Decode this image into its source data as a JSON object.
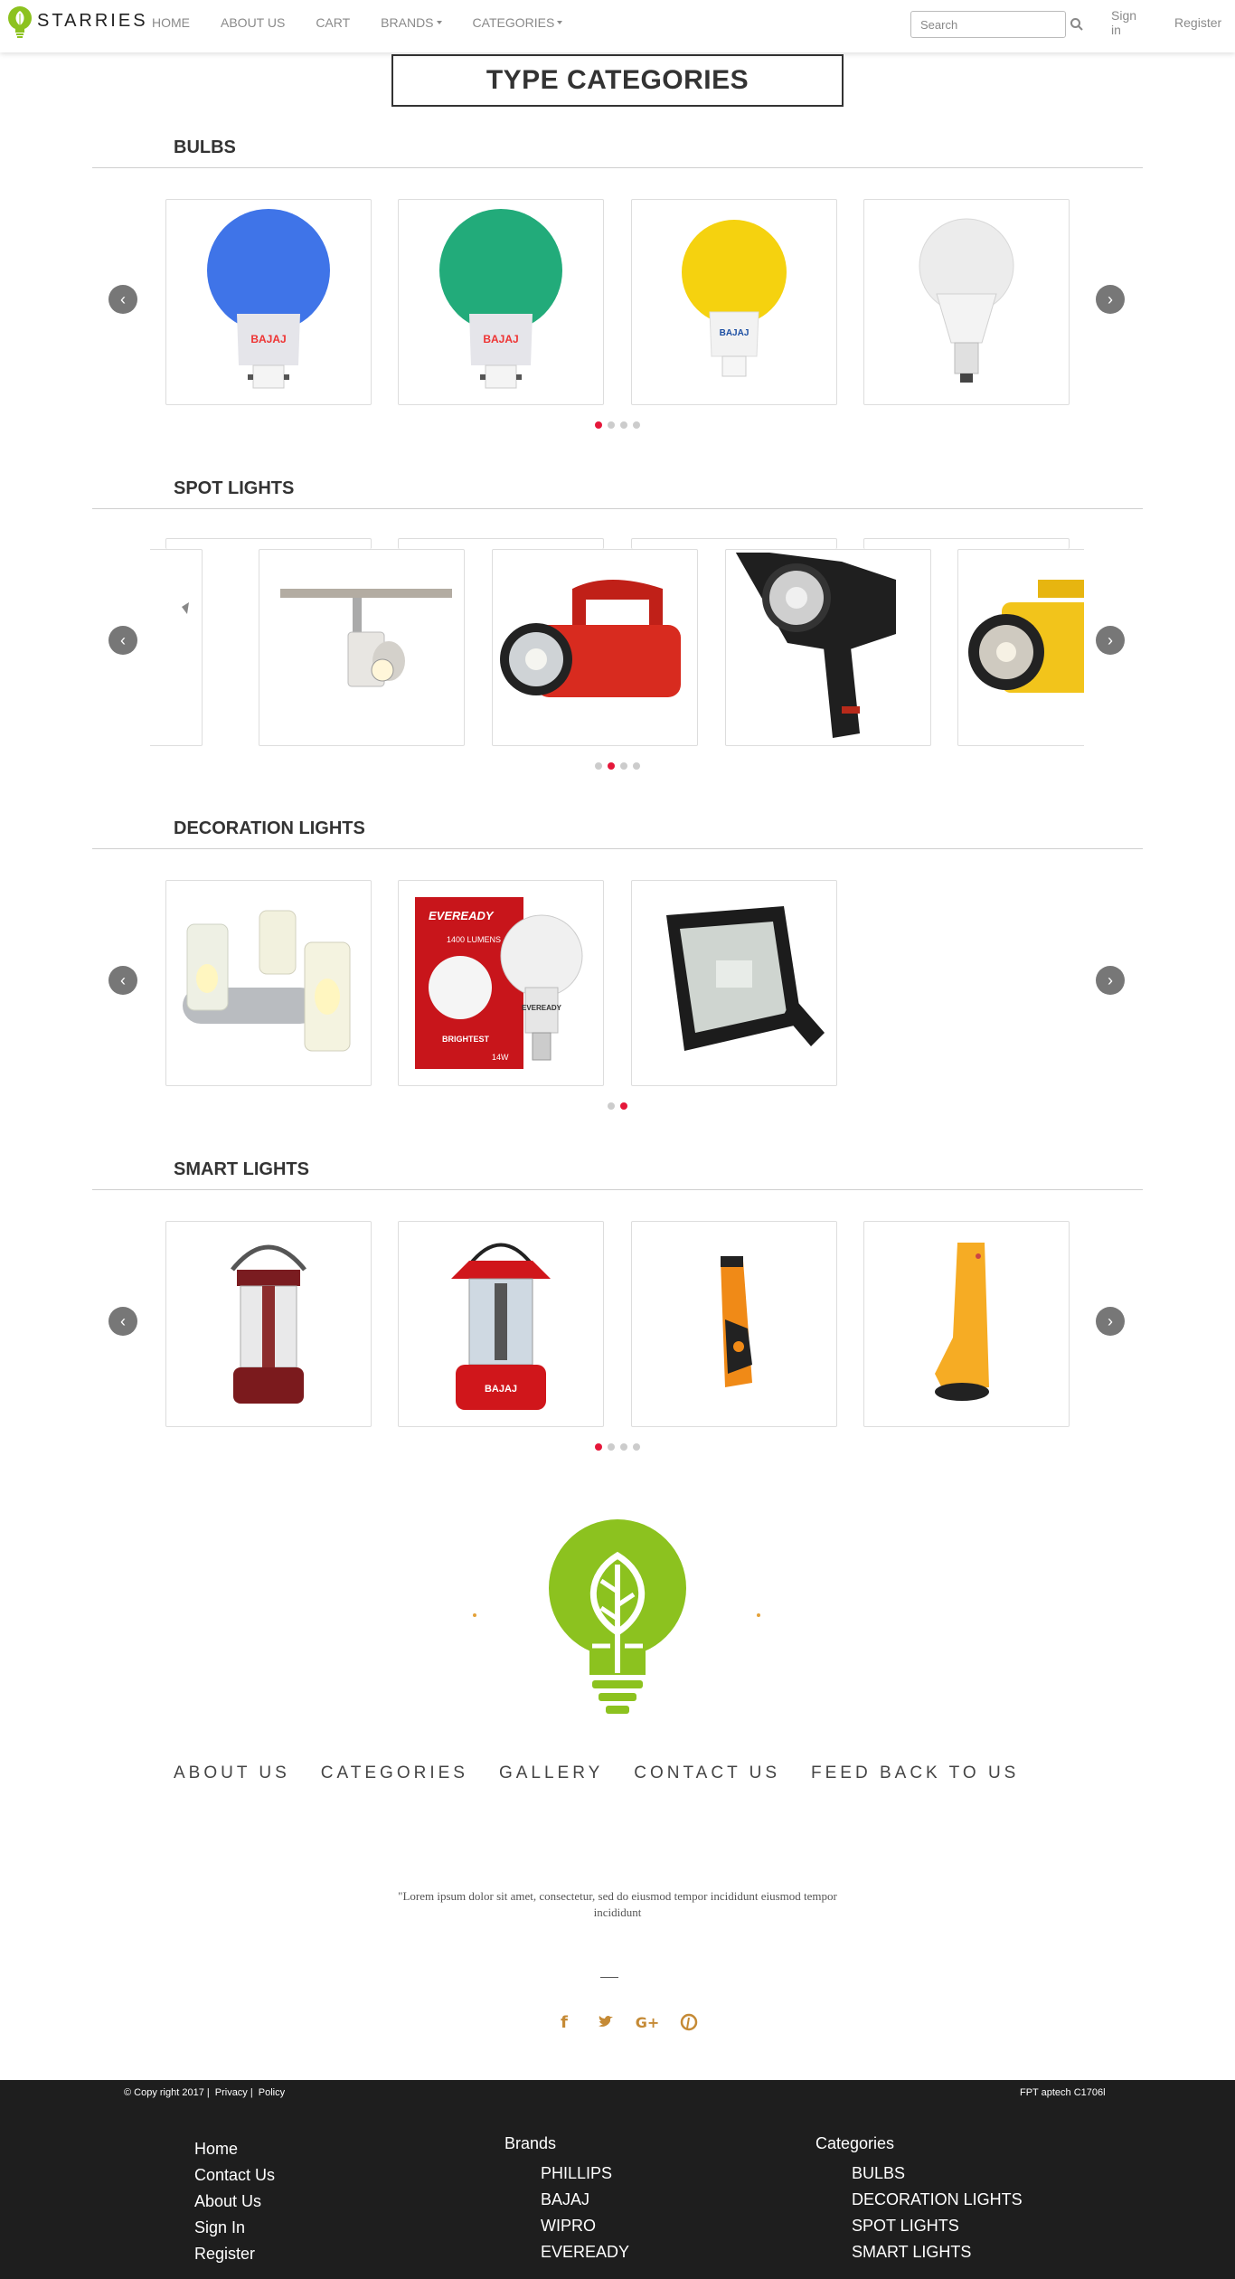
{
  "navbar": {
    "brand": "STARRIES",
    "links": [
      "HOME",
      "ABOUT US",
      "CART"
    ],
    "dropdowns": [
      "BRANDS",
      "CATEGORIES"
    ],
    "search_placeholder": "Search",
    "sign_in": "Sign in",
    "register": "Register"
  },
  "page_title": "TYPE CATEGORIES",
  "sections": [
    {
      "title": "BULBS",
      "products": [
        "blue bulb",
        "green bulb",
        "yellow bulb",
        "white LED bulb"
      ],
      "dots": 4,
      "active_dot": 0
    },
    {
      "title": "SPOT LIGHTS",
      "products": [
        "track spot light",
        "red lantern torch",
        "black spot light",
        "yellow torch"
      ],
      "dots": 4,
      "active_dot": 1
    },
    {
      "title": "DECORATION LIGHTS",
      "products": [
        "candle lights",
        "Eveready LED bulb",
        "flood light"
      ],
      "dots": 2,
      "active_dot": 1
    },
    {
      "title": "SMART LIGHTS",
      "products": [
        "red camping lantern",
        "Bajaj lantern",
        "orange torch",
        "yellow torch"
      ],
      "dots": 4,
      "active_dot": 0
    }
  ],
  "bulb_labels": {
    "brand_red": "BAJAJ"
  },
  "eveready": {
    "brand": "EVEREADY",
    "lumens": "1400 LUMENS",
    "tagline": "BRIGHTEST",
    "watt": "14W"
  },
  "footer_nav": [
    "ABOUT US",
    "CATEGORIES",
    "GALLERY",
    "CONTACT US",
    "FEED BACK TO US"
  ],
  "quote": "\"Lorem ipsum dolor sit amet, consectetur, sed do eiusmod tempor incididunt eiusmod tempor incididunt",
  "social_icons": [
    "facebook-icon",
    "twitter-icon",
    "google-plus-icon",
    "pinterest-icon"
  ],
  "dark_footer": {
    "copyright": "© Copy right 2017",
    "privacy": "Privacy",
    "policy": "Policy",
    "credit": "FPT aptech C1706l",
    "col1": [
      "Home",
      "Contact Us",
      "About Us",
      "Sign In",
      "Register"
    ],
    "brands_head": "Brands",
    "brands": [
      "PHILLIPS",
      "BAJAJ",
      "WIPRO",
      "EVEREADY"
    ],
    "categories_head": "Categories",
    "categories": [
      "BULBS",
      "DECORATION LIGHTS",
      "SPOT LIGHTS",
      "SMART LIGHTS"
    ]
  },
  "colors": {
    "accent": "#8cc21f",
    "dot_active": "#e5173a",
    "social": "#c58a35",
    "footer_bg": "#1e1e1e"
  }
}
